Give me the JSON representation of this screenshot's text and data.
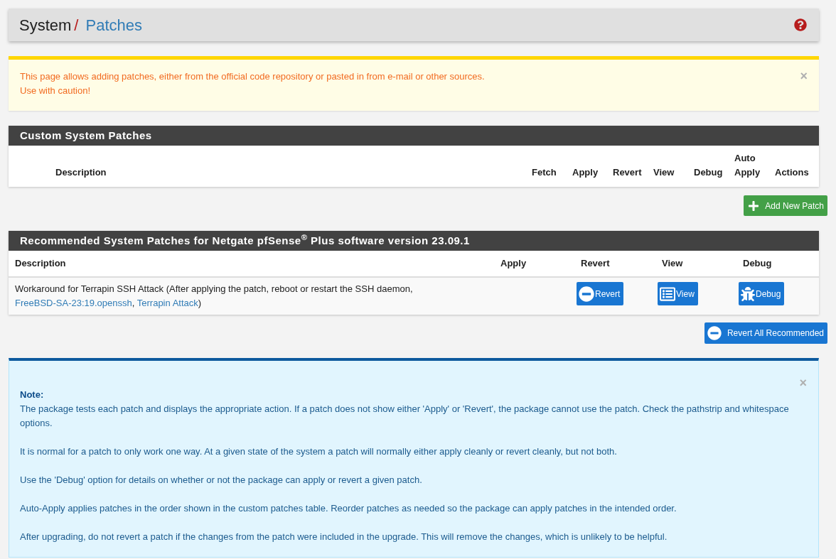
{
  "breadcrumb": {
    "section": "System",
    "separator": "/",
    "page": "Patches"
  },
  "warning_alert": {
    "lines": [
      "This page allows adding patches, either from the official code repository or pasted in from e-mail or other sources.",
      "Use with caution!"
    ],
    "close": "×"
  },
  "custom_panel": {
    "title": "Custom System Patches",
    "columns": [
      "Description",
      "Fetch",
      "Apply",
      "Revert",
      "View",
      "Debug",
      "Auto Apply",
      "Actions"
    ]
  },
  "add_button": {
    "label": "Add New Patch"
  },
  "recommended_panel": {
    "title": "Recommended System Patches for Netgate pfSense$^{®}$ Plus software version 23.09.1",
    "columns": [
      "Description",
      "Apply",
      "Revert",
      "View",
      "Debug"
    ],
    "rows": [
      {
        "description": [
          {
            "kind": "text",
            "text": "Workaround for Terrapin SSH Attack (After applying the patch, reboot or restart the SSH daemon, "
          },
          {
            "kind": "link",
            "text": "FreeBSD-SA-23:19.openssh"
          },
          {
            "kind": "text",
            "text": ", "
          },
          {
            "kind": "link",
            "text": "Terrapin Attack"
          },
          {
            "kind": "text",
            "text": ")"
          }
        ],
        "actions": [
          {
            "kind": "revert",
            "label": "Revert"
          },
          {
            "kind": "view",
            "label": "View"
          },
          {
            "kind": "debug",
            "label": "Debug"
          }
        ]
      }
    ]
  },
  "revert_all_button": {
    "label": "Revert All Recommended"
  },
  "note_alert": {
    "close": "×",
    "heading": "Note:",
    "paragraphs": [
      "The package tests each patch and displays the appropriate action. If a patch does not show either 'Apply' or 'Revert', the package cannot use the patch. Check the pathstrip and whitespace options.",
      "It is normal for a patch to only work one way. At a given state of the system a patch will normally either apply cleanly or revert cleanly, but not both.",
      "Use the 'Debug' option for details on whether or not the package can apply or revert a given patch.",
      "Auto-Apply applies patches in the order shown in the custom patches table. Reorder patches as needed so the package can apply patches in the intended order.",
      "After upgrading, do not revert a patch if the changes from the patch were included in the upgrade. This will remove the changes, which is unlikely to be helpful."
    ]
  }
}
